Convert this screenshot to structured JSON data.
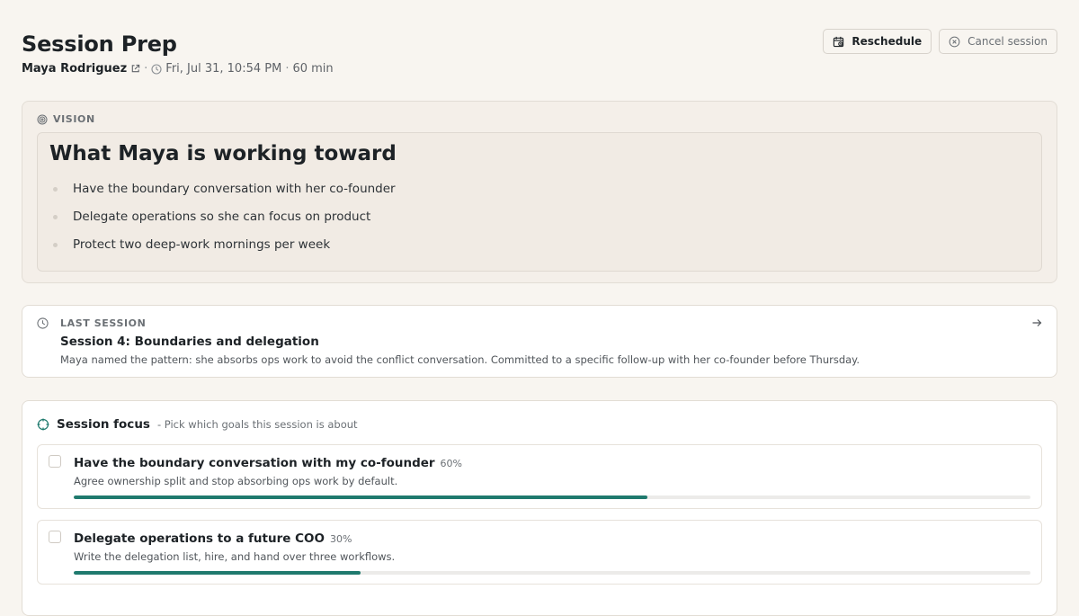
{
  "header": {
    "title": "Session Prep",
    "client_name": "Maya Rodriguez",
    "separator": "·",
    "datetime": "Fri, Jul 31, 10:54 PM",
    "duration": "60 min",
    "reschedule_label": "Reschedule",
    "cancel_label": "Cancel session"
  },
  "vision": {
    "label": "VISION",
    "heading": "What Maya is working toward",
    "items": [
      "Have the boundary conversation with her co-founder",
      "Delegate operations so she can focus on product",
      "Protect two deep-work mornings per week"
    ]
  },
  "last_session": {
    "label": "LAST SESSION",
    "title": "Session 4: Boundaries and delegation",
    "summary": "Maya named the pattern: she absorbs ops work to avoid the conflict conversation. Committed to a specific follow-up with her co-founder before Thursday."
  },
  "focus": {
    "title": "Session focus",
    "hint": "- Pick which goals this session is about",
    "goals": [
      {
        "title": "Have the boundary conversation with my co-founder",
        "progress_label": "60%",
        "progress": 0.6,
        "description": "Agree ownership split and stop absorbing ops work by default.",
        "checked": false
      },
      {
        "title": "Delegate operations to a future COO",
        "progress_label": "30%",
        "progress": 0.3,
        "description": "Write the delegation list, hire, and hand over three workflows.",
        "checked": false
      }
    ]
  },
  "colors": {
    "background": "#f8f5f0",
    "accent": "#1f7a6e",
    "track": "#ecebe9",
    "text_primary": "#1d2226",
    "text_muted": "#6b7075"
  },
  "icons": {
    "external_link": "external-link-icon",
    "clock": "clock-icon",
    "calendar": "calendar-icon",
    "cancel": "cancel-circle-icon",
    "vision": "target-icon",
    "last_session": "history-icon",
    "arrow": "arrow-right-icon",
    "focus": "crosshair-icon"
  }
}
